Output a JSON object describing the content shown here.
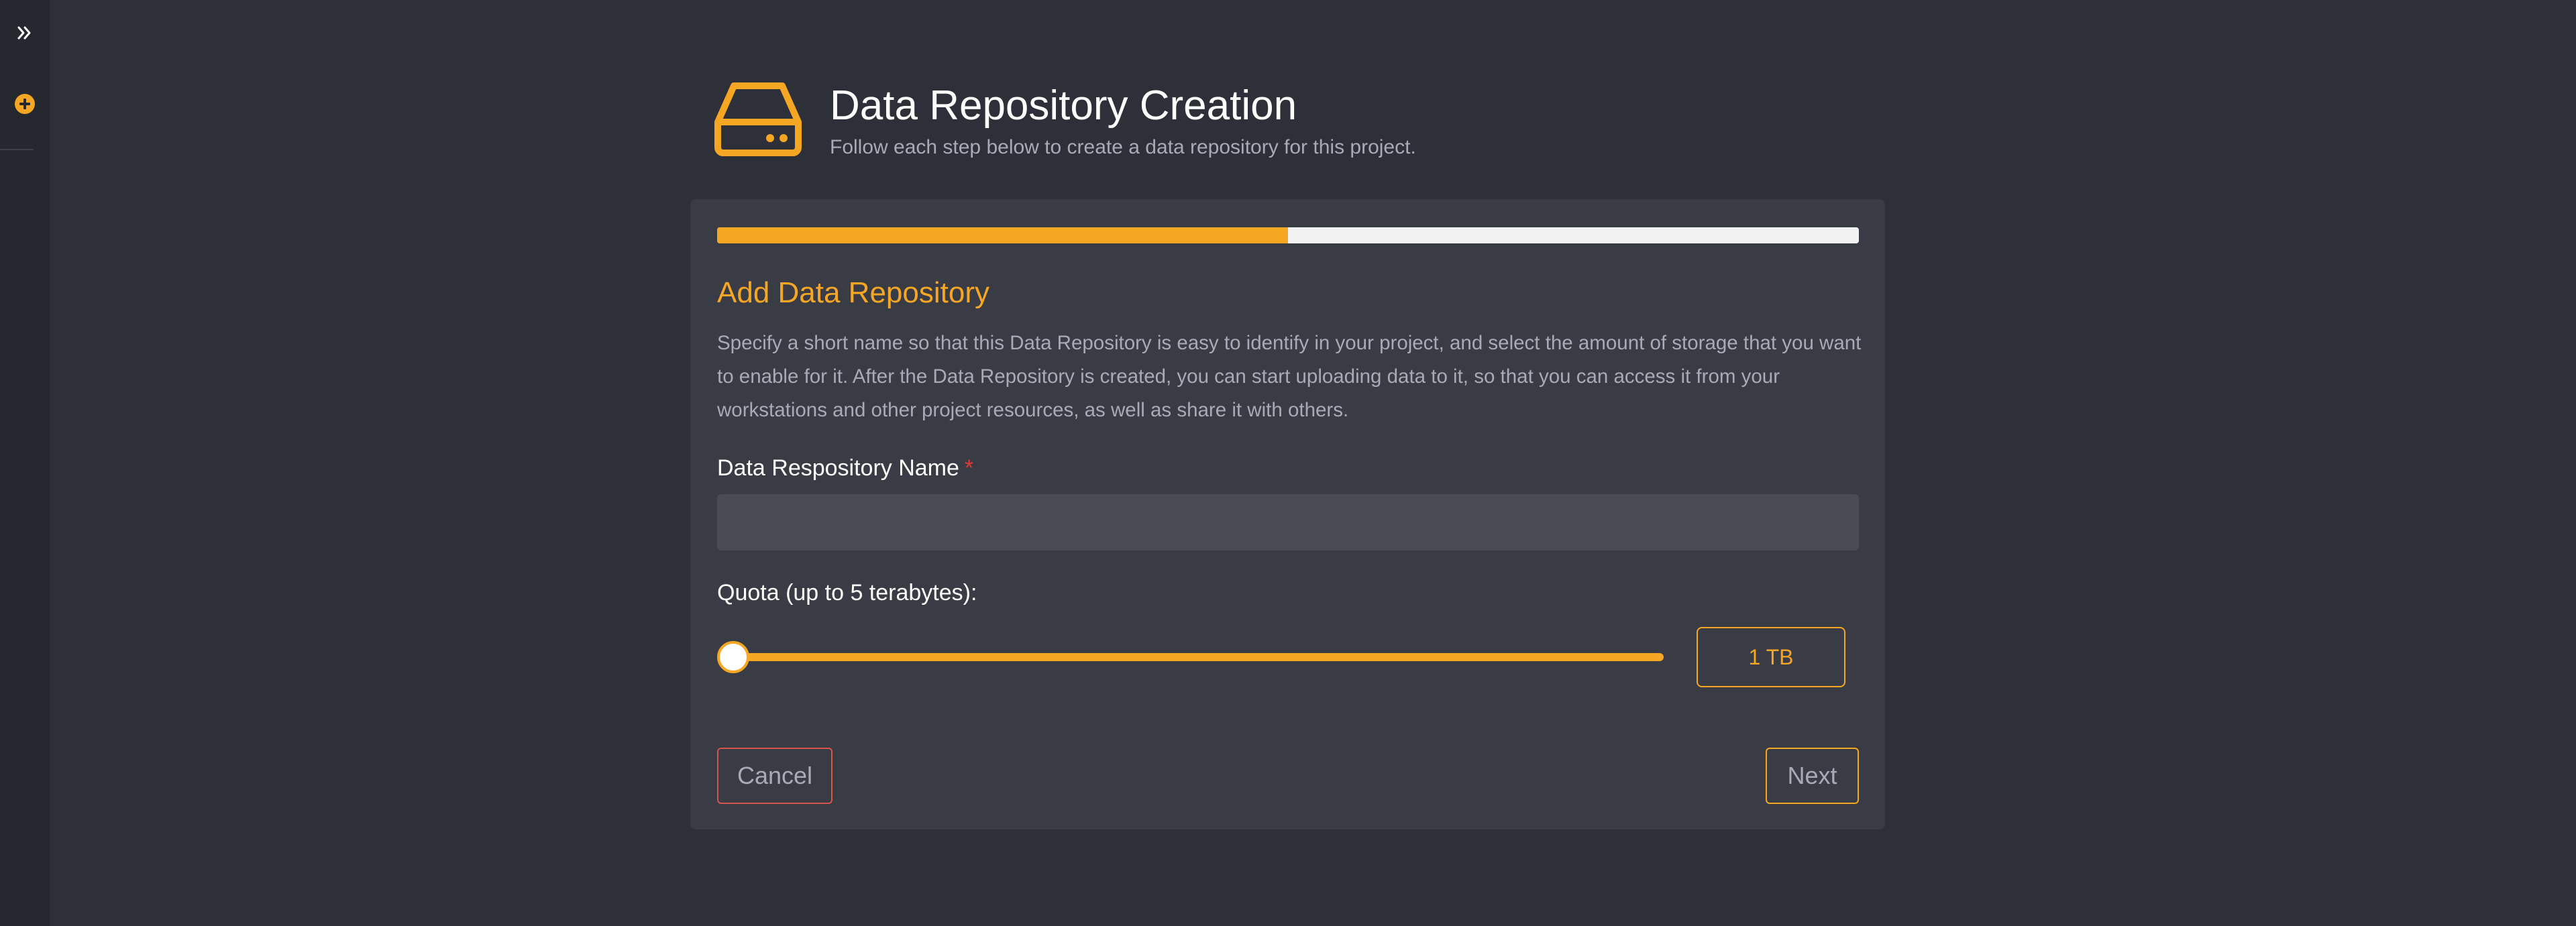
{
  "sidebar": {
    "expand_icon": "double-chevron-right-icon",
    "add_icon": "plus-circle-icon"
  },
  "header": {
    "icon": "hard-drive-icon",
    "title": "Data Repository Creation",
    "subtitle": "Follow each step below to create a data repository for this project."
  },
  "wizard": {
    "progress_percent": 50,
    "step_title": "Add Data Repository",
    "description": "Specify a short name so that this Data Repository is easy to identify in your project, and select the amount of storage that you want to enable for it. After the Data Repository is created, you can start uploading data to it, so that you can access it from your workstations and other project resources, as well as share it with others.",
    "name_label": "Data Respository Name",
    "required_marker": "*",
    "name_value": "",
    "quota_label": "Quota (up to 5 terabytes):",
    "quota_value_tb": 1,
    "quota_display": "1 TB",
    "cancel_label": "Cancel",
    "next_label": "Next"
  },
  "colors": {
    "accent": "#f5a623",
    "danger": "#d9534f",
    "background": "#2e3039",
    "card": "#3a3c45"
  }
}
